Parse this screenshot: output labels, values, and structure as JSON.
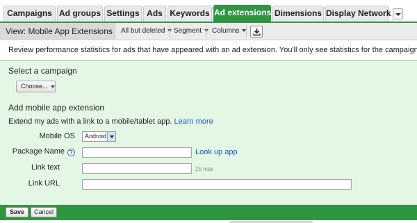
{
  "tabs": [
    "Campaigns",
    "Ad groups",
    "Settings",
    "Ads",
    "Keywords",
    "Ad extensions",
    "Dimensions",
    "Display Network"
  ],
  "active_tab": "Ad extensions",
  "toolbar": {
    "view_label": "View: Mobile App Extensions",
    "filter_label": "All but deleted",
    "segment_label": "Segment",
    "columns_label": "Columns",
    "download_icon": "download-icon"
  },
  "info_text": "Review performance statistics for ads that have appeared with an ad extension. You'll only see statistics for the campaigns you are cu",
  "campaign": {
    "title": "Select a campaign",
    "choose_label": "Choose..."
  },
  "extension": {
    "title": "Add mobile app extension",
    "description": "Extend my ads with a link to a mobile/tablet app.",
    "learn_more": "Learn more",
    "mobile_os_label": "Mobile OS",
    "mobile_os_value": "Android",
    "package_name_label": "Package Name",
    "package_name_value": "",
    "look_up_app": "Look up app",
    "link_text_label": "Link text",
    "link_text_value": "",
    "link_text_note": "25 max",
    "link_url_label": "Link URL",
    "link_url_value": "",
    "help_symbol": "?"
  },
  "actions": {
    "save_label": "Save",
    "cancel_label": "Cancel"
  },
  "colors": {
    "accent_green": "#2e9641",
    "panel_bg": "#e4f7e4",
    "link_blue": "#1a56c8"
  }
}
